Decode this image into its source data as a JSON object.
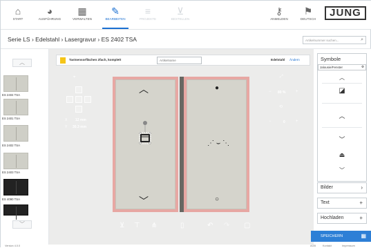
{
  "nav": {
    "items": [
      {
        "label": "Start",
        "icon": "home-icon"
      },
      {
        "label": "Ausführung",
        "icon": "palette-icon"
      },
      {
        "label": "Verwalten",
        "icon": "grid-icon"
      },
      {
        "label": "Bearbeiten",
        "icon": "pen-icon",
        "active": true
      },
      {
        "label": "Projekte",
        "icon": "list-icon",
        "disabled": true
      },
      {
        "label": "Bestellen",
        "icon": "cart-icon",
        "disabled": true
      }
    ],
    "login": "Anmelden",
    "language": "Deutsch",
    "brand": "JUNG"
  },
  "breadcrumb": "Serie LS › Edelstahl › Lasergravur › ES 2402 TSA",
  "search": {
    "placeholder": "Artikelnummer suchen..."
  },
  "rail": {
    "items": [
      {
        "label": "ES 2404 TSA",
        "dark": false
      },
      {
        "label": "ES 2401 TSA",
        "dark": false
      },
      {
        "label": "ES 2402 TSA",
        "dark": false
      },
      {
        "label": "ES 2403 TSA",
        "dark": false
      },
      {
        "label": "ES 4090 TSA",
        "dark": true
      }
    ]
  },
  "toolbar": {
    "title": "Tastsensorflächen 2fach, komplett",
    "field_placeholder": "Artikelname",
    "material": "Edelstahl",
    "change": "Ändern"
  },
  "position": {
    "x_label": "X",
    "x_value": "12 mm",
    "y_label": "Y",
    "y_value": "30.3 mm"
  },
  "size": {
    "zoom": "80 %",
    "rotation": "0"
  },
  "sidebar": {
    "symbols_title": "Symbole",
    "symbols_category": "Jalousie/Fenster",
    "bilder": "Bilder",
    "text": "Text",
    "hochladen": "Hochladen",
    "save": "Speichern"
  },
  "footer": {
    "left": "Version 4.0.0",
    "right1": "AGB",
    "right2": "Kontakt",
    "right3": "Impressum"
  }
}
